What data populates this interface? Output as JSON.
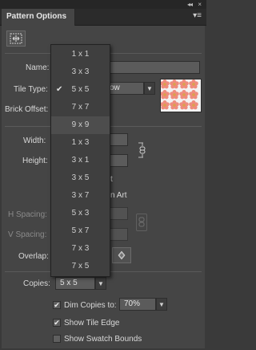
{
  "panel": {
    "collapse_glyph": "◂◂",
    "close_glyph": "×",
    "tab_title": "Pattern Options",
    "menu_glyph": "▾≡"
  },
  "labels": {
    "name": "Name:",
    "tile_type": "Tile Type:",
    "brick_offset": "Brick Offset:",
    "width": "Width:",
    "height": "Height:",
    "h_spacing": "H Spacing:",
    "v_spacing": "V Spacing:",
    "overlap": "Overlap:",
    "copies": "Copies:"
  },
  "fields": {
    "tile_type_partial": "ow",
    "size_tile_partial": "t",
    "move_tile_partial": "n Art",
    "copies_value": "5 x 5",
    "dim_value": "70%"
  },
  "dropdown": {
    "items": [
      "1 x 1",
      "3 x 3",
      "5 x 5",
      "7 x 7",
      "9 x 9",
      "1 x 3",
      "3 x 1",
      "3 x 5",
      "3 x 7",
      "5 x 3",
      "5 x 7",
      "7 x 3",
      "7 x 5"
    ],
    "selected": "5 x 5",
    "hovered": "9 x 9"
  },
  "options": {
    "dim_copies": {
      "label": "Dim Copies to:",
      "checked": true
    },
    "show_tile_edge": {
      "label": "Show Tile Edge",
      "checked": true
    },
    "show_swatch_bounds": {
      "label": "Show Swatch Bounds",
      "checked": false
    }
  },
  "glyphs": {
    "check": "✔",
    "dropdown_arrow": "▼"
  }
}
